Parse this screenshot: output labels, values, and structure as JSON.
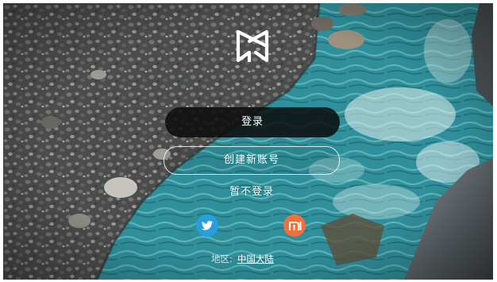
{
  "login": {
    "sign_in_label": "登录",
    "create_account_label": "创建新账号",
    "skip_label": "暂不登录"
  },
  "social": {
    "twitter_icon": "twitter-bird-icon",
    "twitter_color": "#279fde",
    "mi_icon": "mi-logo-icon",
    "mi_color": "#f2703b"
  },
  "region": {
    "label": "地区:",
    "value": "中国大陆"
  },
  "logo": {
    "icon": "brand-logo-icon"
  },
  "colors": {
    "primary_button": "#0c0c0c",
    "text": "#ffffff"
  }
}
